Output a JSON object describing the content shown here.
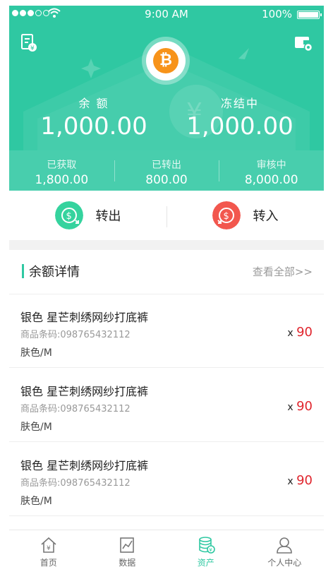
{
  "status_bar": {
    "time": "9:00 AM",
    "battery": "100%"
  },
  "balance": {
    "label": "余 额",
    "value": "1,000.00"
  },
  "frozen": {
    "label": "冻结中",
    "value": "1,000.00"
  },
  "stats": [
    {
      "label": "已获取",
      "value": "1,800.00"
    },
    {
      "label": "已转出",
      "value": "800.00"
    },
    {
      "label": "审核中",
      "value": "8,000.00"
    }
  ],
  "actions": {
    "transfer_out": {
      "label": "转出",
      "color": "#35d39e"
    },
    "transfer_in": {
      "label": "转入",
      "color": "#f2574e"
    }
  },
  "section": {
    "title": "余额详情",
    "view_all": "查看全部>>"
  },
  "items": [
    {
      "name": "银色 星芒刺绣网纱打底裤",
      "code": "商品条码:098765432112",
      "variant": "肤色/M",
      "qty_prefix": "x",
      "qty": "90"
    },
    {
      "name": "银色 星芒刺绣网纱打底裤",
      "code": "商品条码:098765432112",
      "variant": "肤色/M",
      "qty_prefix": "x",
      "qty": "90"
    },
    {
      "name": "银色 星芒刺绣网纱打底裤",
      "code": "商品条码:098765432112",
      "variant": "肤色/M",
      "qty_prefix": "x",
      "qty": "90"
    }
  ],
  "tabs": [
    {
      "label": "首页",
      "icon": "home-icon"
    },
    {
      "label": "数据",
      "icon": "chart-icon"
    },
    {
      "label": "资产",
      "icon": "assets-icon"
    },
    {
      "label": "个人中心",
      "icon": "user-icon"
    }
  ],
  "colors": {
    "accent": "#2fc8a2",
    "qty": "#e0262e"
  }
}
